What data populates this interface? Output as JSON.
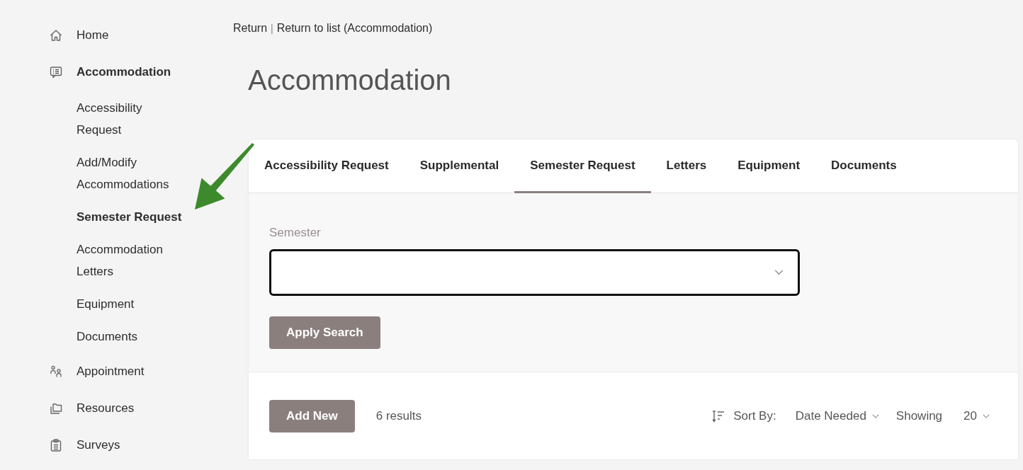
{
  "sidebar": {
    "items": [
      {
        "label": "Home",
        "expanded": false
      },
      {
        "label": "Accommodation",
        "expanded": true,
        "children": [
          {
            "label": "Accessibility Request",
            "selected": false
          },
          {
            "label": "Add/Modify Accommodations",
            "selected": false
          },
          {
            "label": "Semester Request",
            "selected": true
          },
          {
            "label": "Accommodation Letters",
            "selected": false
          },
          {
            "label": "Equipment",
            "selected": false
          },
          {
            "label": "Documents",
            "selected": false
          }
        ]
      },
      {
        "label": "Appointment",
        "expanded": false
      },
      {
        "label": "Resources",
        "expanded": false
      },
      {
        "label": "Surveys",
        "expanded": false
      }
    ]
  },
  "breadcrumb": {
    "links": [
      "Return",
      "Return to list (Accommodation)"
    ],
    "separator": "|"
  },
  "page_title": "Accommodation",
  "tabs": [
    {
      "label": "Accessibility Request",
      "selected": false
    },
    {
      "label": "Supplemental",
      "selected": false
    },
    {
      "label": "Semester Request",
      "selected": true
    },
    {
      "label": "Letters",
      "selected": false
    },
    {
      "label": "Equipment",
      "selected": false
    },
    {
      "label": "Documents",
      "selected": false
    }
  ],
  "filter": {
    "semester": {
      "label": "Semester",
      "focused": true
    },
    "apply_button": "Apply Search"
  },
  "results": {
    "add_button": "Add New",
    "count": "6 results",
    "sort": {
      "label": "Sort By:",
      "value": "Date Needed"
    },
    "page_size": {
      "label": "Showing",
      "value": "20"
    }
  }
}
